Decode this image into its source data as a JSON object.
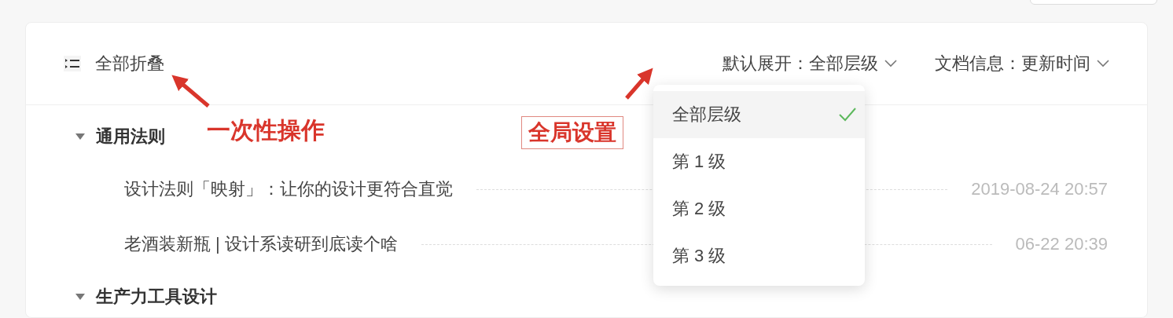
{
  "toolbar": {
    "collapse_all": "全部折叠",
    "default_expand": {
      "label": "默认展开：",
      "value": "全部层级",
      "open": true,
      "options": [
        {
          "label": "全部层级",
          "selected": true
        },
        {
          "label": "第 1 级",
          "selected": false
        },
        {
          "label": "第 2 级",
          "selected": false
        },
        {
          "label": "第 3 级",
          "selected": false
        }
      ]
    },
    "doc_info": {
      "label": "文档信息：",
      "value": "更新时间"
    }
  },
  "outline": [
    {
      "title": "通用法则",
      "expanded": true,
      "children": [
        {
          "title": "设计法则「映射」：让你的设计更符合直觉",
          "date": "2019-08-24 20:57"
        },
        {
          "title": "老酒装新瓶 | 设计系读研到底读个啥",
          "date": "06-22 20:39"
        }
      ]
    },
    {
      "title": "生产力工具设计",
      "expanded": true
    }
  ],
  "annotations": [
    {
      "kind": "plain",
      "text": "一次性操作"
    },
    {
      "kind": "boxed",
      "text": "全局设置"
    }
  ]
}
